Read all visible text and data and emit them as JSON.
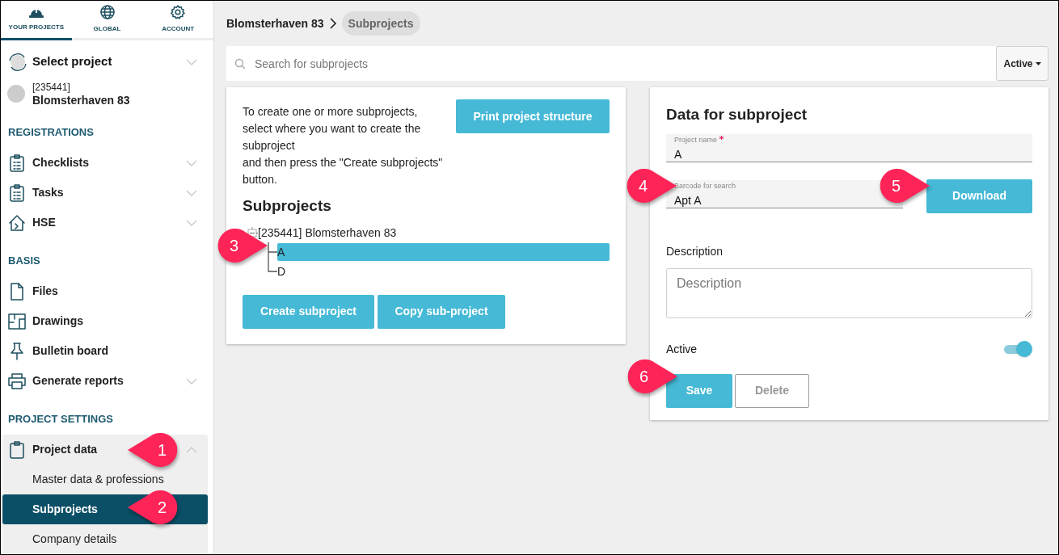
{
  "nav_tabs": [
    {
      "label": "YOUR PROJECTS",
      "selected": true
    },
    {
      "label": "GLOBAL",
      "selected": false
    },
    {
      "label": "ACCOUNT",
      "selected": false
    }
  ],
  "project_selector": {
    "label": "Select project",
    "number": "[235441]",
    "name": "Blomsterhaven 83"
  },
  "sidebar": {
    "sections": [
      {
        "heading": "REGISTRATIONS",
        "items": [
          {
            "label": "Checklists",
            "expanded": false
          },
          {
            "label": "Tasks",
            "expanded": false
          },
          {
            "label": "HSE",
            "expanded": false
          }
        ]
      },
      {
        "heading": "BASIS",
        "items": [
          {
            "label": "Files"
          },
          {
            "label": "Drawings"
          },
          {
            "label": "Bulletin board"
          },
          {
            "label": "Generate reports",
            "expanded": false
          }
        ]
      },
      {
        "heading": "PROJECT SETTINGS",
        "items": [
          {
            "label": "Project data",
            "expanded": true,
            "children": [
              {
                "label": "Master data & professions",
                "selected": false
              },
              {
                "label": "Subprojects",
                "selected": true
              },
              {
                "label": "Company details",
                "selected": false
              }
            ]
          }
        ]
      }
    ]
  },
  "breadcrumb": [
    "Blomsterhaven 83",
    "Subprojects"
  ],
  "search": {
    "placeholder": "Search for subprojects",
    "filter": "Active"
  },
  "structure_panel": {
    "instructions": [
      "To create one or more subprojects,",
      "select where you want to create the",
      "subproject",
      "and then press the \"Create subprojects\"",
      "button."
    ],
    "print_button": "Print project structure",
    "heading": "Subprojects",
    "tree": {
      "label": "[235441] Blomsterhaven 83",
      "expanded": true,
      "children": [
        {
          "label": "A",
          "selected": true
        },
        {
          "label": "D",
          "selected": false
        }
      ]
    },
    "buttons": [
      "Create subproject",
      "Copy sub-project"
    ]
  },
  "details_panel": {
    "title": "Data for subproject",
    "project_name": {
      "label": "Project name",
      "required": true,
      "value": "A"
    },
    "barcode": {
      "label": "Barcode for search",
      "value": "Apt A"
    },
    "download_button": "Download",
    "description": {
      "label": "Description",
      "placeholder": "Description"
    },
    "active": {
      "label": "Active",
      "on": true
    },
    "save_button": "Save",
    "delete_button": "Delete"
  },
  "callouts": [
    "1",
    "2",
    "3",
    "4",
    "5",
    "6"
  ]
}
